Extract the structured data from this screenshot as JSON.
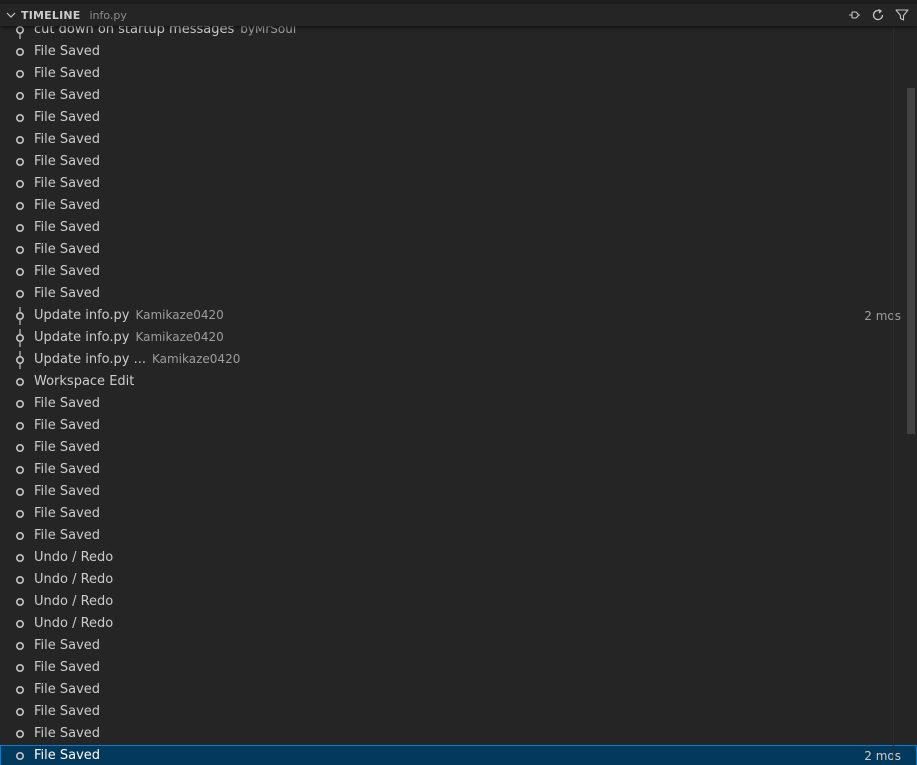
{
  "header": {
    "title": "TIMELINE",
    "subtitle": "info.py"
  },
  "actions": [
    "pin-icon",
    "refresh-icon",
    "filter-icon"
  ],
  "rows": [
    {
      "label": "cut down on startup messages",
      "desc": "byMrSoul",
      "time": "",
      "kind": "commit"
    },
    {
      "label": "File Saved",
      "desc": "",
      "time": "",
      "kind": "local"
    },
    {
      "label": "File Saved",
      "desc": "",
      "time": "",
      "kind": "local"
    },
    {
      "label": "File Saved",
      "desc": "",
      "time": "",
      "kind": "local"
    },
    {
      "label": "File Saved",
      "desc": "",
      "time": "",
      "kind": "local"
    },
    {
      "label": "File Saved",
      "desc": "",
      "time": "",
      "kind": "local"
    },
    {
      "label": "File Saved",
      "desc": "",
      "time": "",
      "kind": "local"
    },
    {
      "label": "File Saved",
      "desc": "",
      "time": "",
      "kind": "local"
    },
    {
      "label": "File Saved",
      "desc": "",
      "time": "",
      "kind": "local"
    },
    {
      "label": "File Saved",
      "desc": "",
      "time": "",
      "kind": "local"
    },
    {
      "label": "File Saved",
      "desc": "",
      "time": "",
      "kind": "local"
    },
    {
      "label": "File Saved",
      "desc": "",
      "time": "",
      "kind": "local"
    },
    {
      "label": "File Saved",
      "desc": "",
      "time": "",
      "kind": "local"
    },
    {
      "label": "Update info.py",
      "desc": "Kamikaze0420",
      "time": "2 mos",
      "kind": "commit"
    },
    {
      "label": "Update info.py",
      "desc": "Kamikaze0420",
      "time": "",
      "kind": "commit"
    },
    {
      "label": "Update info.py ...",
      "desc": "Kamikaze0420",
      "time": "",
      "kind": "commit"
    },
    {
      "label": "Workspace Edit",
      "desc": "",
      "time": "",
      "kind": "local"
    },
    {
      "label": "File Saved",
      "desc": "",
      "time": "",
      "kind": "local"
    },
    {
      "label": "File Saved",
      "desc": "",
      "time": "",
      "kind": "local"
    },
    {
      "label": "File Saved",
      "desc": "",
      "time": "",
      "kind": "local"
    },
    {
      "label": "File Saved",
      "desc": "",
      "time": "",
      "kind": "local"
    },
    {
      "label": "File Saved",
      "desc": "",
      "time": "",
      "kind": "local"
    },
    {
      "label": "File Saved",
      "desc": "",
      "time": "",
      "kind": "local"
    },
    {
      "label": "File Saved",
      "desc": "",
      "time": "",
      "kind": "local"
    },
    {
      "label": "Undo / Redo",
      "desc": "",
      "time": "",
      "kind": "local"
    },
    {
      "label": "Undo / Redo",
      "desc": "",
      "time": "",
      "kind": "local"
    },
    {
      "label": "Undo / Redo",
      "desc": "",
      "time": "",
      "kind": "local"
    },
    {
      "label": "Undo / Redo",
      "desc": "",
      "time": "",
      "kind": "local"
    },
    {
      "label": "File Saved",
      "desc": "",
      "time": "",
      "kind": "local"
    },
    {
      "label": "File Saved",
      "desc": "",
      "time": "",
      "kind": "local"
    },
    {
      "label": "File Saved",
      "desc": "",
      "time": "",
      "kind": "local"
    },
    {
      "label": "File Saved",
      "desc": "",
      "time": "",
      "kind": "local"
    },
    {
      "label": "File Saved",
      "desc": "",
      "time": "",
      "kind": "local"
    },
    {
      "label": "File Saved",
      "desc": "",
      "time": "2 mos",
      "kind": "local",
      "selected": true
    }
  ],
  "colors": {
    "background": "#252526",
    "selection": "#04395e",
    "focus_border": "#007fd4",
    "text": "#cccccc",
    "muted": "#9d9d9d"
  }
}
